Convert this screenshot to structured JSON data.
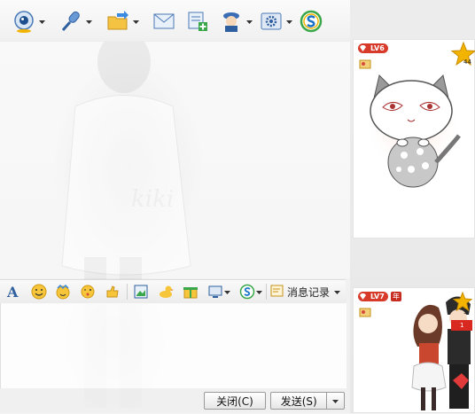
{
  "toolbar": {
    "icons": [
      "webcam-icon",
      "microphone-icon",
      "send-file-icon",
      "mail-icon",
      "add-contact-icon",
      "assistant-icon",
      "settings-icon",
      "search-s-icon"
    ]
  },
  "input_toolbar": {
    "icons": [
      "font-icon",
      "smiley-icon",
      "magic-face-icon",
      "wink-icon",
      "nudge-icon",
      "screenshot-icon",
      "duck-icon",
      "gift-icon",
      "screen-share-icon",
      "soso-icon"
    ],
    "history_label": "消息记录"
  },
  "bottom_bar": {
    "close_label": "关闭(C)",
    "send_label": "发送(S)"
  },
  "profile_top": {
    "level_badge": "LV6",
    "star_count": "44"
  },
  "profile_bottom": {
    "level_badge": "LV7",
    "year_badge": "年",
    "badge_count": "3",
    "flag_count": "1"
  },
  "colors": {
    "accent": "#1a73c8",
    "badge_red": "#d83a2a",
    "star_gold": "#f2b400"
  }
}
